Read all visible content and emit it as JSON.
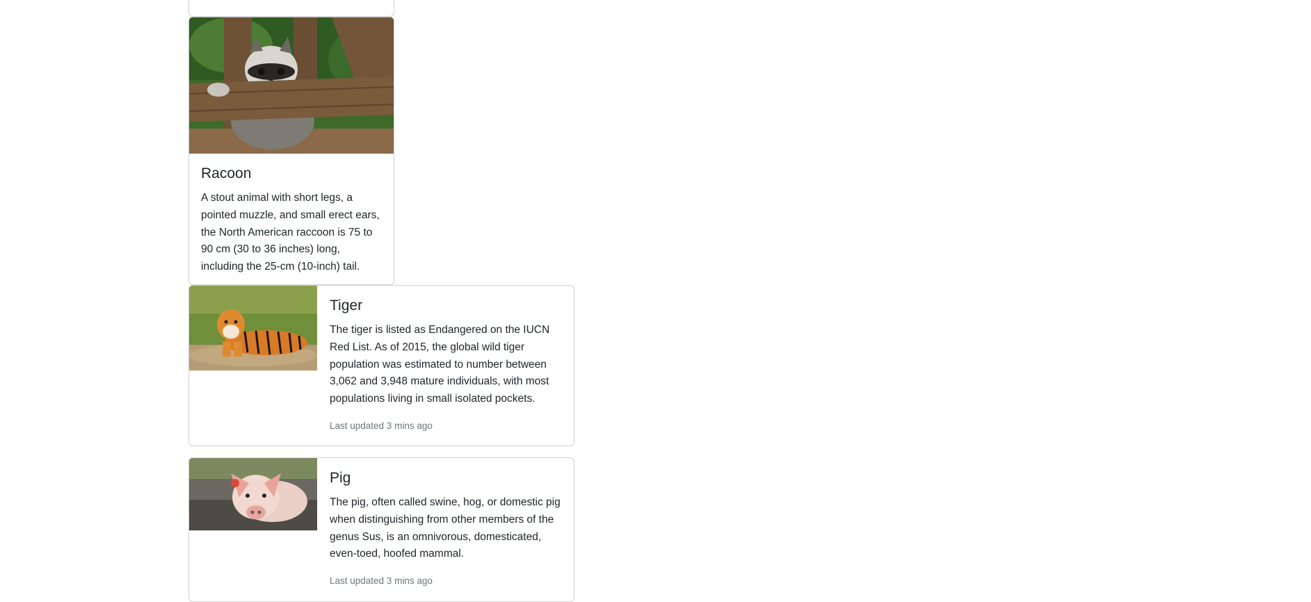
{
  "cards": [
    {
      "title": "Racoon",
      "text": "A stout animal with short legs, a pointed muzzle, and small erect ears, the North American raccoon is 75 to 90 cm (30 to 36 inches) long, including the 25-cm (10-inch) tail."
    },
    {
      "title": "Tiger",
      "text": "The tiger is listed as Endangered on the IUCN Red List. As of 2015, the global wild tiger population was estimated to number between 3,062 and 3,948 mature individuals, with most populations living in small isolated pockets.",
      "updated": "Last updated 3 mins ago"
    },
    {
      "title": "Pig",
      "text": "The pig, often called swine, hog, or domestic pig when distinguishing from other members of the genus Sus, is an omnivorous, domesticated, even-toed, hoofed mammal.",
      "updated": "Last updated 3 mins ago"
    }
  ],
  "colors": {
    "card_border": "#d4d6d9",
    "muted_text": "#6c757d",
    "body_text": "#212529"
  }
}
